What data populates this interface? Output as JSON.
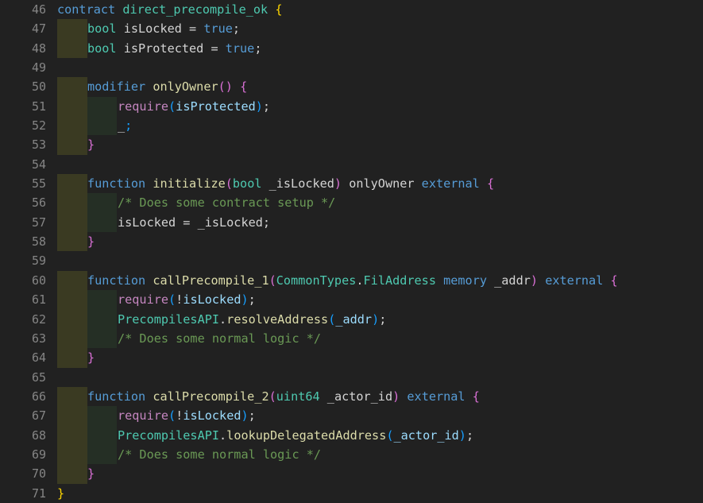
{
  "editor": {
    "language": "solidity",
    "theme": "dark-plus",
    "background_color": "#212121",
    "gutter_color": "#858585",
    "first_visible_line": 46,
    "last_visible_line": 71,
    "indent_guide_level1_color": "#3a3a22",
    "indent_guide_level2_color": "#252f25",
    "colors": {
      "keyword": "#569cd6",
      "type": "#4ec9b0",
      "function": "#dcdcaa",
      "plain": "#d4d4d4",
      "variable": "#9cdcfe",
      "comment": "#6a9955",
      "control": "#c586c0",
      "bracket_level0": "#ffd700",
      "bracket_level1": "#da70d6",
      "bracket_level2": "#179fff"
    }
  },
  "lines": [
    {
      "number": "46",
      "indent": 0,
      "tokens": [
        {
          "t": "contract",
          "c": "kw"
        },
        {
          "t": " ",
          "c": "plain"
        },
        {
          "t": "direct_precompile_ok",
          "c": "type"
        },
        {
          "t": " ",
          "c": "plain"
        },
        {
          "t": "{",
          "c": "b0"
        }
      ]
    },
    {
      "number": "47",
      "indent": 1,
      "tokens": [
        {
          "t": "bool",
          "c": "type"
        },
        {
          "t": " isLocked = ",
          "c": "plain"
        },
        {
          "t": "true",
          "c": "kw"
        },
        {
          "t": ";",
          "c": "plain"
        }
      ]
    },
    {
      "number": "48",
      "indent": 1,
      "tokens": [
        {
          "t": "bool",
          "c": "type"
        },
        {
          "t": " isProtected = ",
          "c": "plain"
        },
        {
          "t": "true",
          "c": "kw"
        },
        {
          "t": ";",
          "c": "plain"
        }
      ]
    },
    {
      "number": "49",
      "indent": 0,
      "tokens": []
    },
    {
      "number": "50",
      "indent": 1,
      "tokens": [
        {
          "t": "modifier",
          "c": "kw"
        },
        {
          "t": " ",
          "c": "plain"
        },
        {
          "t": "onlyOwner",
          "c": "fn"
        },
        {
          "t": "()",
          "c": "b1"
        },
        {
          "t": " ",
          "c": "plain"
        },
        {
          "t": "{",
          "c": "b1"
        }
      ]
    },
    {
      "number": "51",
      "indent": 2,
      "tokens": [
        {
          "t": "require",
          "c": "req"
        },
        {
          "t": "(",
          "c": "b2"
        },
        {
          "t": "isProtected",
          "c": "var"
        },
        {
          "t": ")",
          "c": "b2"
        },
        {
          "t": ";",
          "c": "plain"
        }
      ]
    },
    {
      "number": "52",
      "indent": 2,
      "tokens": [
        {
          "t": "_",
          "c": "plain"
        },
        {
          "t": ";",
          "c": "b2"
        }
      ]
    },
    {
      "number": "53",
      "indent": 1,
      "tokens": [
        {
          "t": "}",
          "c": "b1"
        }
      ]
    },
    {
      "number": "54",
      "indent": 0,
      "tokens": []
    },
    {
      "number": "55",
      "indent": 1,
      "tokens": [
        {
          "t": "function",
          "c": "kw"
        },
        {
          "t": " ",
          "c": "plain"
        },
        {
          "t": "initialize",
          "c": "fn"
        },
        {
          "t": "(",
          "c": "b1"
        },
        {
          "t": "bool",
          "c": "type"
        },
        {
          "t": " _isLocked",
          "c": "plain"
        },
        {
          "t": ")",
          "c": "b1"
        },
        {
          "t": " onlyOwner ",
          "c": "plain"
        },
        {
          "t": "external",
          "c": "kw"
        },
        {
          "t": " ",
          "c": "plain"
        },
        {
          "t": "{",
          "c": "b1"
        }
      ]
    },
    {
      "number": "56",
      "indent": 2,
      "tokens": [
        {
          "t": "/* Does some contract setup */",
          "c": "comment"
        }
      ]
    },
    {
      "number": "57",
      "indent": 2,
      "tokens": [
        {
          "t": "isLocked = _isLocked;",
          "c": "plain"
        }
      ]
    },
    {
      "number": "58",
      "indent": 1,
      "tokens": [
        {
          "t": "}",
          "c": "b1"
        }
      ]
    },
    {
      "number": "59",
      "indent": 0,
      "tokens": []
    },
    {
      "number": "60",
      "indent": 1,
      "tokens": [
        {
          "t": "function",
          "c": "kw"
        },
        {
          "t": " ",
          "c": "plain"
        },
        {
          "t": "callPrecompile_1",
          "c": "fn"
        },
        {
          "t": "(",
          "c": "b1"
        },
        {
          "t": "CommonTypes",
          "c": "type"
        },
        {
          "t": ".",
          "c": "plain"
        },
        {
          "t": "FilAddress",
          "c": "type"
        },
        {
          "t": " ",
          "c": "plain"
        },
        {
          "t": "memory",
          "c": "kw"
        },
        {
          "t": " _addr",
          "c": "plain"
        },
        {
          "t": ")",
          "c": "b1"
        },
        {
          "t": " ",
          "c": "plain"
        },
        {
          "t": "external",
          "c": "kw"
        },
        {
          "t": " ",
          "c": "plain"
        },
        {
          "t": "{",
          "c": "b1"
        }
      ]
    },
    {
      "number": "61",
      "indent": 2,
      "tokens": [
        {
          "t": "require",
          "c": "req"
        },
        {
          "t": "(",
          "c": "b2"
        },
        {
          "t": "!",
          "c": "plain"
        },
        {
          "t": "isLocked",
          "c": "var"
        },
        {
          "t": ")",
          "c": "b2"
        },
        {
          "t": ";",
          "c": "plain"
        }
      ]
    },
    {
      "number": "62",
      "indent": 2,
      "tokens": [
        {
          "t": "PrecompilesAPI",
          "c": "type"
        },
        {
          "t": ".",
          "c": "plain"
        },
        {
          "t": "resolveAddress",
          "c": "fn"
        },
        {
          "t": "(",
          "c": "b2"
        },
        {
          "t": "_addr",
          "c": "var"
        },
        {
          "t": ")",
          "c": "b2"
        },
        {
          "t": ";",
          "c": "plain"
        }
      ]
    },
    {
      "number": "63",
      "indent": 2,
      "tokens": [
        {
          "t": "/* Does some normal logic */",
          "c": "comment"
        }
      ]
    },
    {
      "number": "64",
      "indent": 1,
      "tokens": [
        {
          "t": "}",
          "c": "b1"
        }
      ]
    },
    {
      "number": "65",
      "indent": 0,
      "tokens": []
    },
    {
      "number": "66",
      "indent": 1,
      "tokens": [
        {
          "t": "function",
          "c": "kw"
        },
        {
          "t": " ",
          "c": "plain"
        },
        {
          "t": "callPrecompile_2",
          "c": "fn"
        },
        {
          "t": "(",
          "c": "b1"
        },
        {
          "t": "uint64",
          "c": "type"
        },
        {
          "t": " _actor_id",
          "c": "plain"
        },
        {
          "t": ")",
          "c": "b1"
        },
        {
          "t": " ",
          "c": "plain"
        },
        {
          "t": "external",
          "c": "kw"
        },
        {
          "t": " ",
          "c": "plain"
        },
        {
          "t": "{",
          "c": "b1"
        }
      ]
    },
    {
      "number": "67",
      "indent": 2,
      "tokens": [
        {
          "t": "require",
          "c": "req"
        },
        {
          "t": "(",
          "c": "b2"
        },
        {
          "t": "!",
          "c": "plain"
        },
        {
          "t": "isLocked",
          "c": "var"
        },
        {
          "t": ")",
          "c": "b2"
        },
        {
          "t": ";",
          "c": "plain"
        }
      ]
    },
    {
      "number": "68",
      "indent": 2,
      "tokens": [
        {
          "t": "PrecompilesAPI",
          "c": "type"
        },
        {
          "t": ".",
          "c": "plain"
        },
        {
          "t": "lookupDelegatedAddress",
          "c": "fn"
        },
        {
          "t": "(",
          "c": "b2"
        },
        {
          "t": "_actor_id",
          "c": "var"
        },
        {
          "t": ")",
          "c": "b2"
        },
        {
          "t": ";",
          "c": "plain"
        }
      ]
    },
    {
      "number": "69",
      "indent": 2,
      "tokens": [
        {
          "t": "/* Does some normal logic */",
          "c": "comment"
        }
      ]
    },
    {
      "number": "70",
      "indent": 1,
      "tokens": [
        {
          "t": "}",
          "c": "b1"
        }
      ]
    },
    {
      "number": "71",
      "indent": 0,
      "tokens": [
        {
          "t": "}",
          "c": "b0"
        }
      ]
    }
  ]
}
